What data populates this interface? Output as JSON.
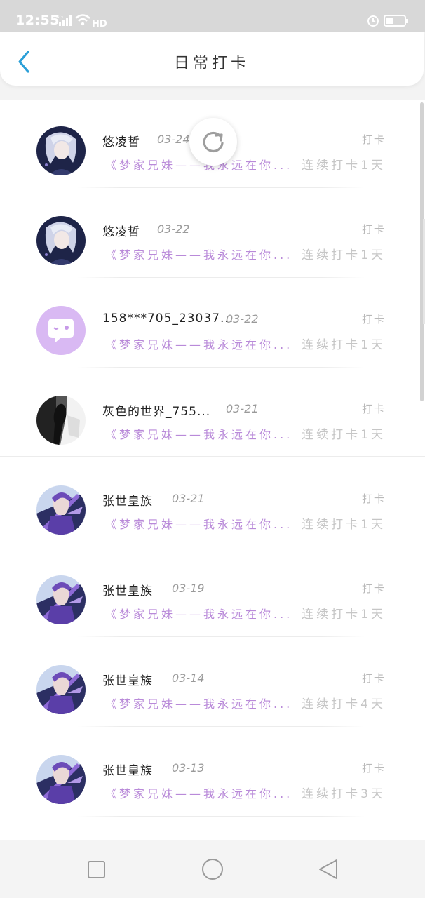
{
  "status_bar": {
    "time": "12:55",
    "network": "4G",
    "wifi_label": "HD"
  },
  "header": {
    "title": "日常打卡",
    "accent_color": "#2a9fd8"
  },
  "entries": [
    {
      "name": "悠凌哲",
      "date": "03-24",
      "action": "打卡",
      "quote": "《梦家兄妹——我永远在你...",
      "streak": "连续打卡1天",
      "avatar": "anime-silver-hair"
    },
    {
      "name": "悠凌哲",
      "date": "03-22",
      "action": "打卡",
      "quote": "《梦家兄妹——我永远在你...",
      "streak": "连续打卡1天",
      "avatar": "anime-silver-hair"
    },
    {
      "name": "158***705_23037...",
      "date": "03-22",
      "action": "打卡",
      "quote": "《梦家兄妹——我永远在你...",
      "streak": "连续打卡1天",
      "avatar": "default-chat-bubble"
    },
    {
      "name": "灰色的世界_755...",
      "date": "03-21",
      "action": "打卡",
      "quote": "《梦家兄妹——我永远在你...",
      "streak": "连续打卡1天",
      "avatar": "monochrome-figure"
    },
    {
      "name": "张世皇族",
      "date": "03-21",
      "action": "打卡",
      "quote": "《梦家兄妹——我永远在你...",
      "streak": "连续打卡1天",
      "avatar": "anime-purple-warrior"
    },
    {
      "name": "张世皇族",
      "date": "03-19",
      "action": "打卡",
      "quote": "《梦家兄妹——我永远在你...",
      "streak": "连续打卡1天",
      "avatar": "anime-purple-warrior"
    },
    {
      "name": "张世皇族",
      "date": "03-14",
      "action": "打卡",
      "quote": "《梦家兄妹——我永远在你...",
      "streak": "连续打卡4天",
      "avatar": "anime-purple-warrior"
    },
    {
      "name": "张世皇族",
      "date": "03-13",
      "action": "打卡",
      "quote": "《梦家兄妹——我永远在你...",
      "streak": "连续打卡3天",
      "avatar": "anime-purple-warrior"
    }
  ],
  "colors": {
    "quote": "#b98ad9",
    "muted": "#c6c6c6",
    "default_avatar_bg": "#d9b9f3"
  },
  "icons": {
    "back": "chevron-left-icon",
    "refresh": "refresh-icon",
    "nav_recent": "square-icon",
    "nav_home": "circle-icon",
    "nav_back": "triangle-back-icon"
  }
}
